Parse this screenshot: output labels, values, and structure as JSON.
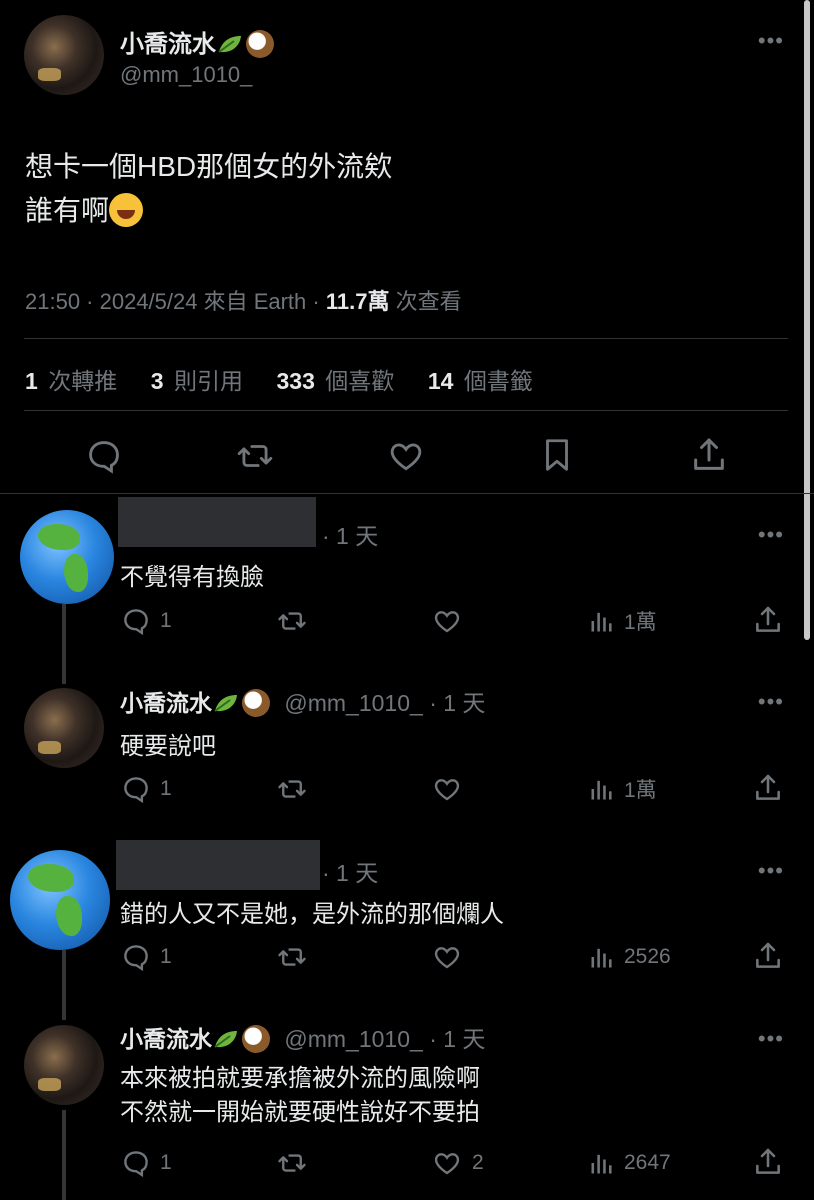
{
  "tweet": {
    "display_name": "小喬流水",
    "handle": "@mm_1010_",
    "text_line1": "想卡一個HBD那個女的外流欸",
    "text_line2": "誰有啊",
    "meta_time": "21:50 · 2024/5/24 來自 Earth ·",
    "views_value": "11.7萬",
    "views_label": "次查看",
    "stats": {
      "retweets_value": "1",
      "retweets_label": "次轉推",
      "quotes_value": "3",
      "quotes_label": "則引用",
      "likes_value": "333",
      "likes_label": "個喜歡",
      "bookmarks_value": "14",
      "bookmarks_label": "個書籤"
    },
    "actions": [
      "reply-icon",
      "retweet-icon",
      "like-icon",
      "bookmark-icon",
      "share-icon"
    ]
  },
  "replies": [
    {
      "author": "",
      "handle": "",
      "time": "· 1 天",
      "text1": "不覺得有換臉",
      "text2": "",
      "reply_count": "1",
      "like_count": "",
      "views": "1萬",
      "avatar": "globe"
    },
    {
      "author": "小喬流水",
      "handle": "@mm_1010_",
      "time": "· 1 天",
      "text1": "硬要說吧",
      "text2": "",
      "reply_count": "1",
      "like_count": "",
      "views": "1萬",
      "avatar": "photo"
    },
    {
      "author": "",
      "handle": "",
      "time": "· 1 天",
      "text1": "錯的人又不是她，是外流的那個爛人",
      "text2": "",
      "reply_count": "1",
      "like_count": "",
      "views": "2526",
      "avatar": "globe"
    },
    {
      "author": "小喬流水",
      "handle": "@mm_1010_",
      "time": "· 1 天",
      "text1": "本來被拍就要承擔被外流的風險啊",
      "text2": "不然就一開始就要硬性說好不要拍",
      "reply_count": "1",
      "like_count": "2",
      "views": "2647",
      "avatar": "photo"
    }
  ],
  "more_label": "•••",
  "colors": {
    "background": "#000000",
    "text": "#e7e9ea",
    "secondary": "#71767b",
    "divider": "#2f3336"
  }
}
